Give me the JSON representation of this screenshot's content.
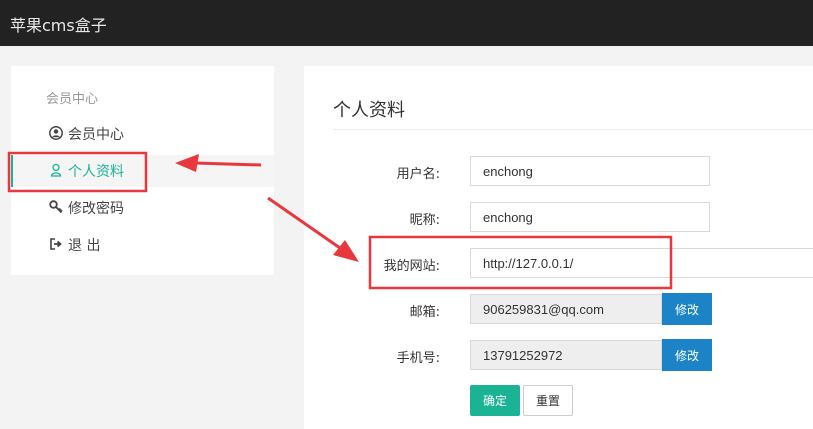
{
  "app": {
    "title": "苹果cms盒子"
  },
  "sidebar": {
    "title": "会员中心",
    "items": [
      {
        "label": "会员中心",
        "icon": "user-circle-icon"
      },
      {
        "label": "个人资料",
        "icon": "user-outline-icon",
        "active": true
      },
      {
        "label": "修改密码",
        "icon": "key-icon"
      },
      {
        "label": "退 出",
        "icon": "sign-out-icon"
      }
    ]
  },
  "main": {
    "title": "个人资料",
    "form": {
      "username": {
        "label": "用户名:",
        "value": "enchong"
      },
      "nickname": {
        "label": "昵称:",
        "value": "enchong"
      },
      "website": {
        "label": "我的网站:",
        "value": "http://127.0.0.1/"
      },
      "email": {
        "label": "邮箱:",
        "value": "906259831@qq.com",
        "button": "修改"
      },
      "phone": {
        "label": "手机号:",
        "value": "13791252972",
        "button": "修改"
      }
    },
    "buttons": {
      "confirm": "确定",
      "reset": "重置"
    }
  },
  "colors": {
    "accent": "#1ab394",
    "primary": "#1c84c6",
    "topbar": "#222222",
    "annotation": "#e8383d"
  }
}
